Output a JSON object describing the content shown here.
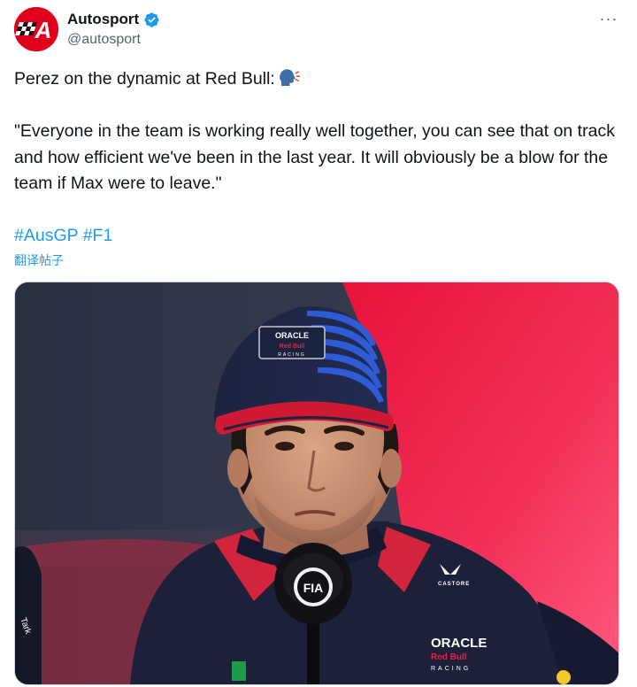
{
  "tweet": {
    "author": {
      "display_name": "Autosport",
      "handle": "@autosport",
      "avatar_letter": "A",
      "verified": true
    },
    "more_label": "···",
    "text": {
      "line1": "Perez on the dynamic at Red Bull:",
      "quote": "\"Everyone in the team is working really well together, you can see that on track and how efficient we've been in the last year. It will obviously be a blow for the team if Max were to leave.\"",
      "hashtags": [
        "#AusGP",
        "#F1"
      ]
    },
    "translate_label": "翻译帖子",
    "media": {
      "cap_text_top": "ORACLE",
      "cap_text_mid": "Red Bull",
      "cap_text_bottom": "RACING",
      "mic_label": "FIA",
      "jacket_text": "ORACLE",
      "jacket_text_mid": "Red Bull",
      "jacket_text_bottom": "RACING",
      "castore_text": "CASTORE"
    },
    "colors": {
      "brand_red": "#e0001b",
      "link_blue": "#1d9bf0",
      "text_primary": "#0f1419",
      "text_secondary": "#536471"
    }
  }
}
